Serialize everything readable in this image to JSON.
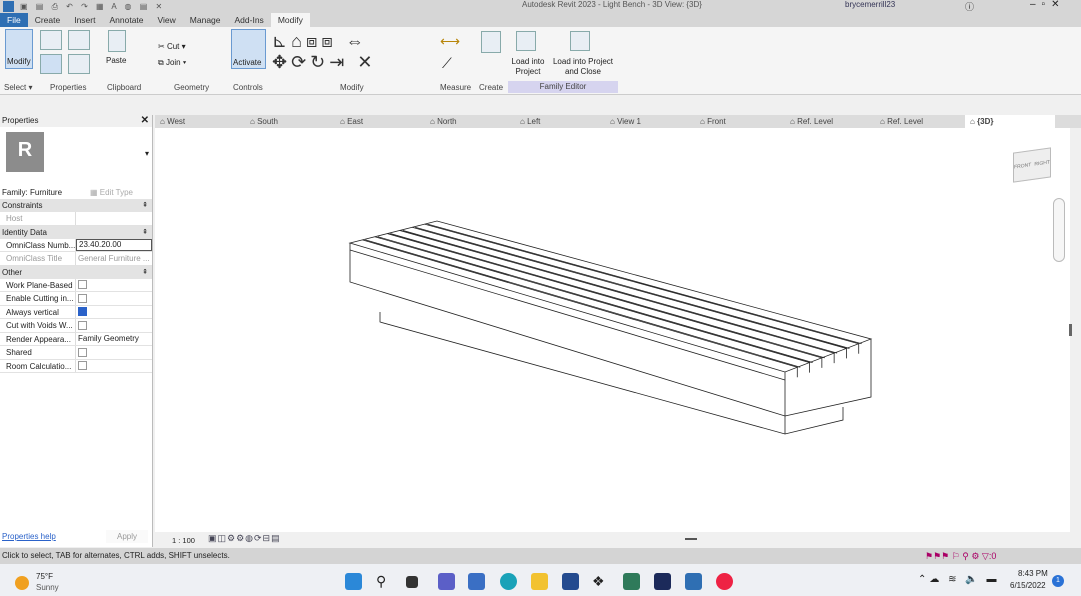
{
  "window": {
    "title": "Autodesk Revit 2023 - Light Bench - 3D View: {3D}",
    "user": "brycemerrill23"
  },
  "ribbon_tabs": [
    "File",
    "Create",
    "Insert",
    "Annotate",
    "View",
    "Manage",
    "Add-Ins",
    "Modify"
  ],
  "ribbon": {
    "modify_btn": "Modify",
    "paste": "Paste",
    "cut": "Cut",
    "join": "Join",
    "activate": "Activate",
    "load_into_project": "Load into Project",
    "load_into_project_close": "Load into Project and Close",
    "panels": {
      "select": "Select ▾",
      "properties": "Properties",
      "clipboard": "Clipboard",
      "geometry": "Geometry",
      "controls": "Controls",
      "modify": "Modify",
      "measure": "Measure",
      "create": "Create",
      "family_editor": "Family Editor"
    }
  },
  "properties": {
    "title": "Properties",
    "family": "Family: Furniture",
    "edit_type": "Edit Type",
    "groups": {
      "constraints": "Constraints",
      "identity": "Identity Data",
      "other": "Other"
    },
    "host": "Host",
    "omniclass_number_label": "OmniClass Numb...",
    "omniclass_number": "23.40.20.00",
    "omniclass_title_label": "OmniClass Title",
    "omniclass_title": "General Furniture ...",
    "other_rows": [
      {
        "k": "Work Plane-Based",
        "checked": false
      },
      {
        "k": "Enable Cutting in...",
        "checked": false
      },
      {
        "k": "Always vertical",
        "checked": true
      },
      {
        "k": "Cut with Voids W...",
        "checked": false
      },
      {
        "k": "Render Appeara...",
        "v": "Family Geometry"
      },
      {
        "k": "Shared",
        "checked": false
      },
      {
        "k": "Room Calculatio...",
        "checked": false
      }
    ],
    "help": "Properties help",
    "apply": "Apply"
  },
  "view_tabs": [
    "West",
    "South",
    "East",
    "North",
    "Left",
    "View 1",
    "Front",
    "Ref. Level",
    "Ref. Level",
    "{3D}"
  ],
  "view_bar": {
    "scale": "1 : 100"
  },
  "status": "Click to select, TAB for alternates, CTRL adds, SHIFT unselects.",
  "status_filter_count": ":0",
  "taskbar": {
    "temp": "75°F",
    "weather": "Sunny",
    "time": "8:43 PM",
    "date": "6/15/2022",
    "notif": "1"
  },
  "viewcube": {
    "front": "FRONT",
    "right": "RIGHT"
  }
}
